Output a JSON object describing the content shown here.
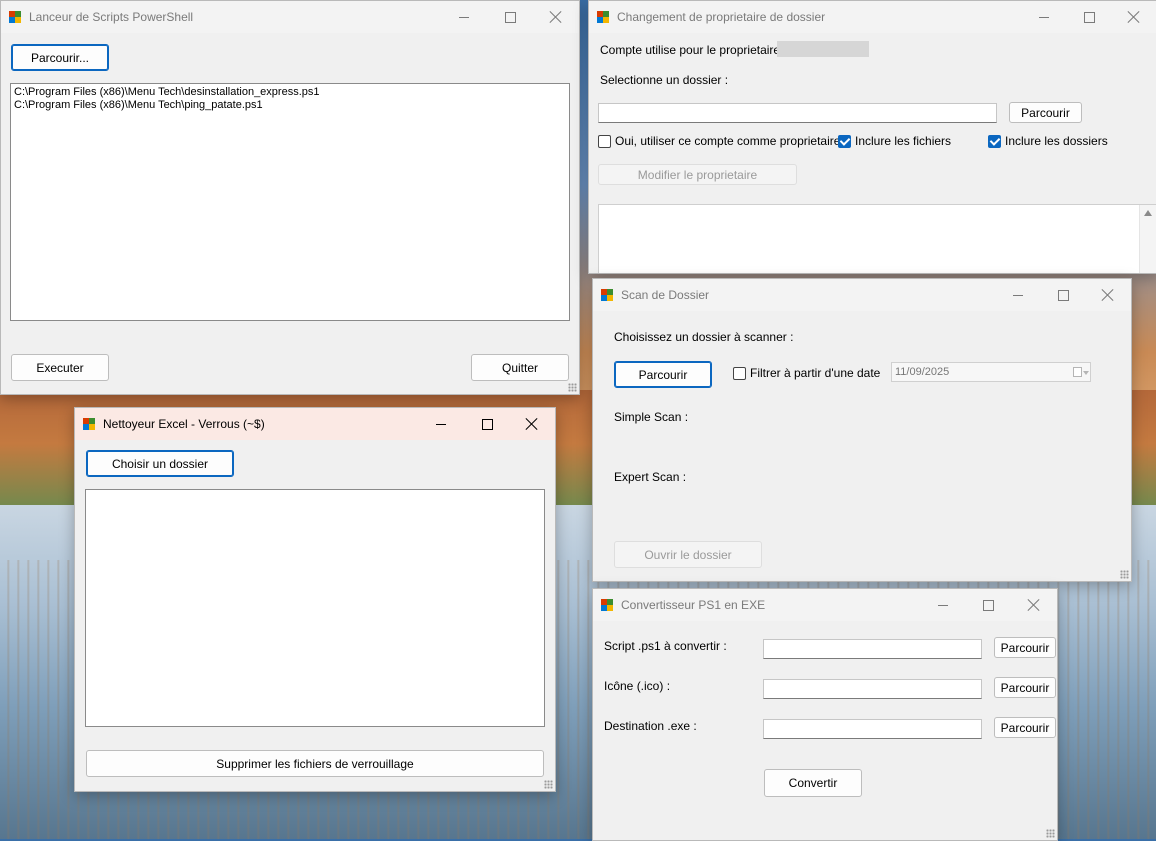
{
  "windows": {
    "launcher": {
      "title": "Lanceur de Scripts PowerShell",
      "browse_label": "Parcourir...",
      "scripts": [
        "C:\\Program Files (x86)\\Menu Tech\\desinstallation_express.ps1",
        "C:\\Program Files (x86)\\Menu Tech\\ping_patate.ps1"
      ],
      "execute_label": "Executer",
      "quit_label": "Quitter"
    },
    "owner": {
      "title": "Changement de proprietaire de dossier",
      "account_label": "Compte utilise pour le proprietaire :",
      "select_folder_label": "Selectionne un dossier :",
      "folder_path": "",
      "browse_label": "Parcourir",
      "use_account_label": "Oui, utiliser ce compte comme proprietaire",
      "use_account_checked": false,
      "include_files_label": "Inclure les fichiers",
      "include_files_checked": true,
      "include_folders_label": "Inclure les dossiers",
      "include_folders_checked": true,
      "modify_label": "Modifier le proprietaire"
    },
    "scan": {
      "title": "Scan de Dossier",
      "choose_label": "Choisissez un dossier à scanner :",
      "browse_label": "Parcourir",
      "filter_label": "Filtrer à partir d'une date",
      "filter_checked": false,
      "date_value": "11/09/2025",
      "simple_scan_label": "Simple Scan :",
      "expert_scan_label": "Expert Scan :",
      "open_folder_label": "Ouvrir le dossier"
    },
    "excel": {
      "title": "Nettoyeur Excel - Verrous (~$)",
      "choose_folder_label": "Choisir un dossier",
      "delete_label": "Supprimer les fichiers de verrouillage"
    },
    "converter": {
      "title": "Convertisseur PS1 en EXE",
      "script_label": "Script .ps1 à convertir :",
      "icon_label": "Icône (.ico) :",
      "dest_label": "Destination .exe :",
      "browse_label": "Parcourir",
      "convert_label": "Convertir"
    }
  },
  "colors": {
    "accent": "#0b67c0",
    "active_titlebar": "#fbe9e4",
    "window_bg": "#f0f0f0"
  },
  "icons": {
    "app": "winforms-app-icon",
    "minimize": "minimize-icon",
    "maximize": "maximize-icon",
    "close": "close-icon",
    "calendar": "calendar-dropdown-icon"
  }
}
